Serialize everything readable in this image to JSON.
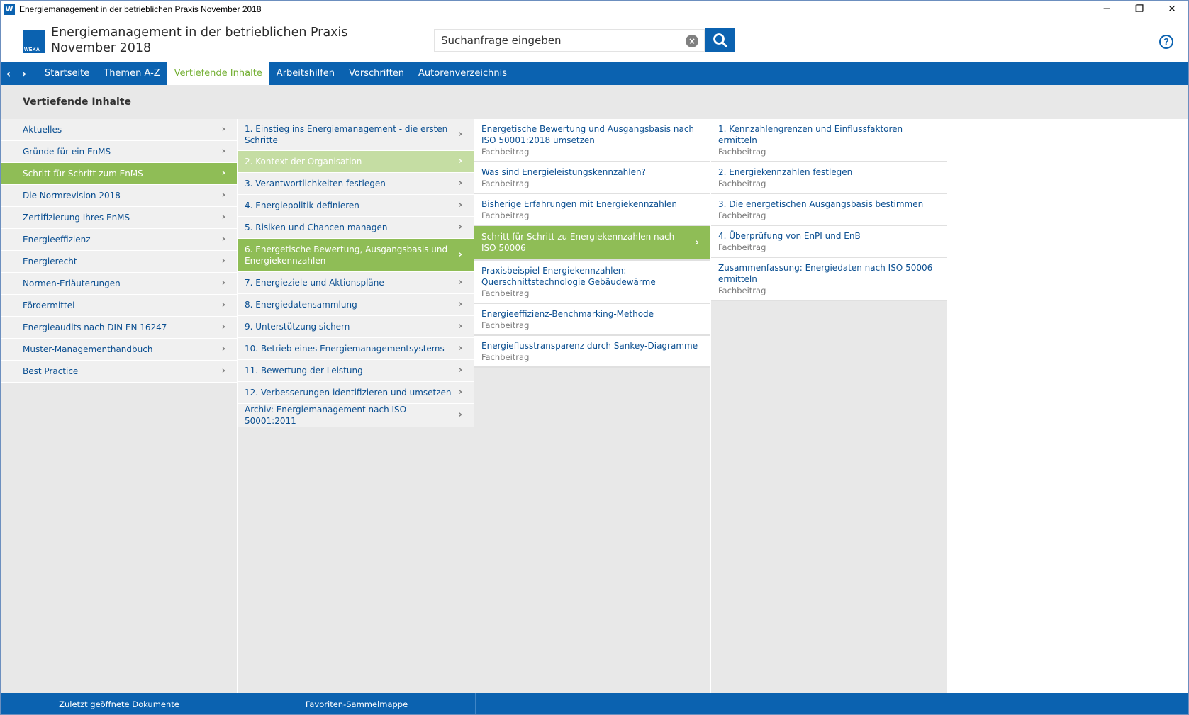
{
  "window": {
    "title": "Energiemanagement in der betrieblichen Praxis November 2018",
    "app_icon": "W",
    "controls": {
      "minimize": "─",
      "restore": "❐",
      "close": "✕"
    }
  },
  "header": {
    "logo_text": "WEKA",
    "title_line1": "Energiemanagement in der betrieblichen Praxis",
    "title_line2": "November 2018",
    "search_placeholder": "Suchanfrage eingeben",
    "help": "?"
  },
  "nav": {
    "back": "‹",
    "forward": "›",
    "tabs": [
      {
        "label": "Startseite",
        "active": false
      },
      {
        "label": "Themen A-Z",
        "active": false
      },
      {
        "label": "Vertiefende Inhalte",
        "active": true
      },
      {
        "label": "Arbeitshilfen",
        "active": false
      },
      {
        "label": "Vorschriften",
        "active": false
      },
      {
        "label": "Autorenverzeichnis",
        "active": false
      }
    ]
  },
  "section_title": "Vertiefende Inhalte",
  "col1": [
    "Aktuelles",
    "Gründe für ein EnMS",
    "Schritt für Schritt zum EnMS",
    "Die Normrevision 2018",
    "Zertifizierung Ihres EnMS",
    "Energieeffizienz",
    "Energierecht",
    "Normen-Erläuterungen",
    "Fördermittel",
    "Energieaudits nach DIN EN 16247",
    "Muster-Managementhandbuch",
    "Best Practice"
  ],
  "col2": [
    "1. Einstieg ins Energiemanagement - die ersten Schritte",
    "2. Kontext der Organisation",
    "3. Verantwortlichkeiten festlegen",
    "4. Energiepolitik definieren",
    "5. Risiken und Chancen managen",
    "6. Energetische Bewertung, Ausgangsbasis und Energiekennzahlen",
    "7. Energieziele und Aktionspläne",
    "8. Energiedatensammlung",
    "9. Unterstützung sichern",
    "10. Betrieb eines Energiemanagementsystems",
    "11. Bewertung der Leistung",
    "12. Verbesserungen identifizieren und umsetzen",
    "Archiv: Energiemanagement nach ISO 50001:2011"
  ],
  "col3": [
    {
      "title": "Energetische Bewertung und Ausgangsbasis nach ISO 50001:2018 umsetzen",
      "sub": "Fachbeitrag"
    },
    {
      "title": "Was sind Energieleistungskennzahlen?",
      "sub": "Fachbeitrag"
    },
    {
      "title": "Bisherige Erfahrungen mit Energiekennzahlen",
      "sub": "Fachbeitrag"
    },
    {
      "title": "Schritt für Schritt zu Energiekennzahlen nach ISO 50006",
      "sub": ""
    },
    {
      "title": "Praxisbeispiel Energiekennzahlen: Querschnittstechnologie Gebäudewärme",
      "sub": "Fachbeitrag"
    },
    {
      "title": "Energieeffizienz-Benchmarking-Methode",
      "sub": "Fachbeitrag"
    },
    {
      "title": "Energieflusstransparenz durch Sankey-Diagramme",
      "sub": "Fachbeitrag"
    }
  ],
  "col4": [
    {
      "title": "1. Kennzahlengrenzen und Einflussfaktoren ermitteln",
      "sub": "Fachbeitrag"
    },
    {
      "title": "2. Energiekennzahlen festlegen",
      "sub": "Fachbeitrag"
    },
    {
      "title": "3. Die energetischen Ausgangsbasis bestimmen",
      "sub": "Fachbeitrag"
    },
    {
      "title": "4. Überprüfung von EnPI und EnB",
      "sub": "Fachbeitrag"
    },
    {
      "title": "Zusammenfassung: Energiedaten nach ISO 50006 ermitteln",
      "sub": "Fachbeitrag"
    }
  ],
  "chevron": "›",
  "footer": {
    "recent": "Zuletzt geöffnete Dokumente",
    "favorites": "Favoriten-Sammelmappe"
  },
  "colors": {
    "brand_blue": "#0b62b0",
    "accent_green": "#8fbd56",
    "light_green": "#c5dda3"
  }
}
